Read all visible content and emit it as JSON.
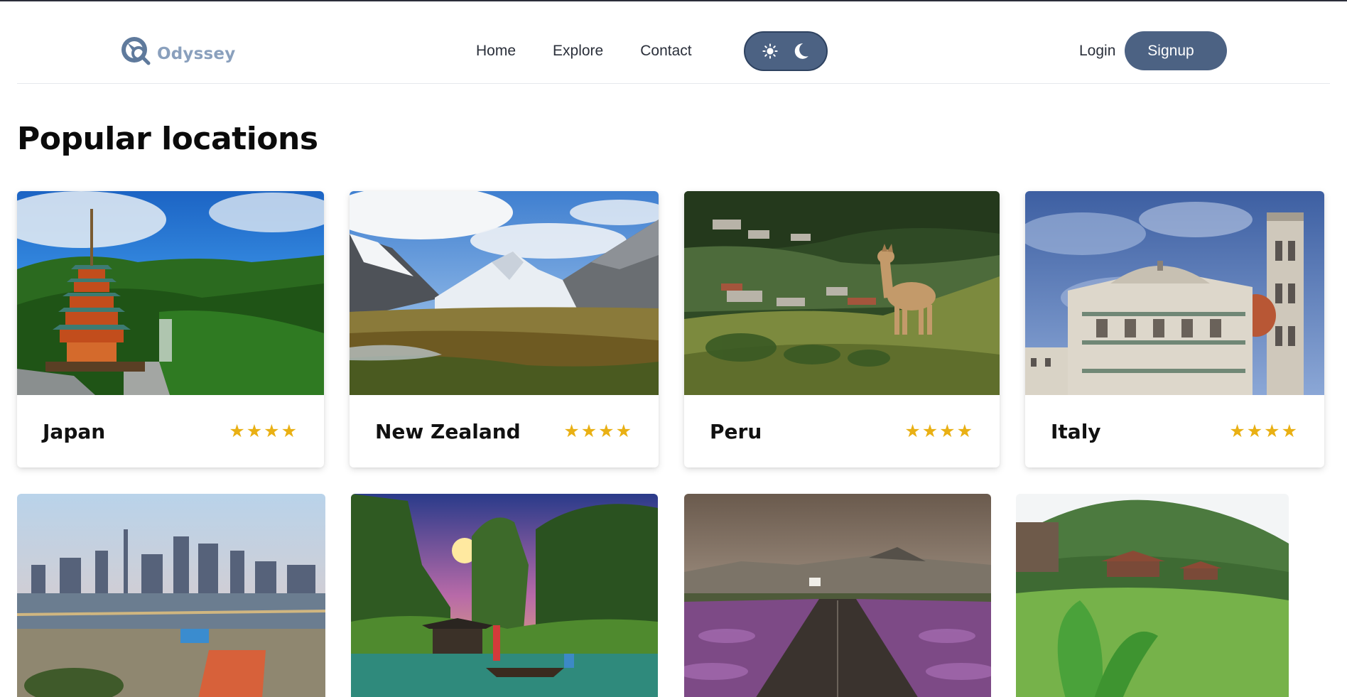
{
  "brand": {
    "name": "Odyssey",
    "logo_icon": "compass-search-icon"
  },
  "nav": {
    "links": [
      "Home",
      "Explore",
      "Contact"
    ],
    "theme_toggle": {
      "light_icon": "sun-icon",
      "dark_icon": "moon-icon"
    },
    "login": "Login",
    "signup": "Signup"
  },
  "colors": {
    "primary": "#4c6283",
    "star": "#e9b014",
    "logo": "#8aa0bd"
  },
  "page": {
    "title": "Popular locations"
  },
  "locations": [
    {
      "name": "Japan",
      "rating": 4,
      "stars": "★★★★"
    },
    {
      "name": "New Zealand",
      "rating": 4,
      "stars": "★★★★"
    },
    {
      "name": "Peru",
      "rating": 4,
      "stars": "★★★★"
    },
    {
      "name": "Italy",
      "rating": 4,
      "stars": "★★★★"
    }
  ]
}
